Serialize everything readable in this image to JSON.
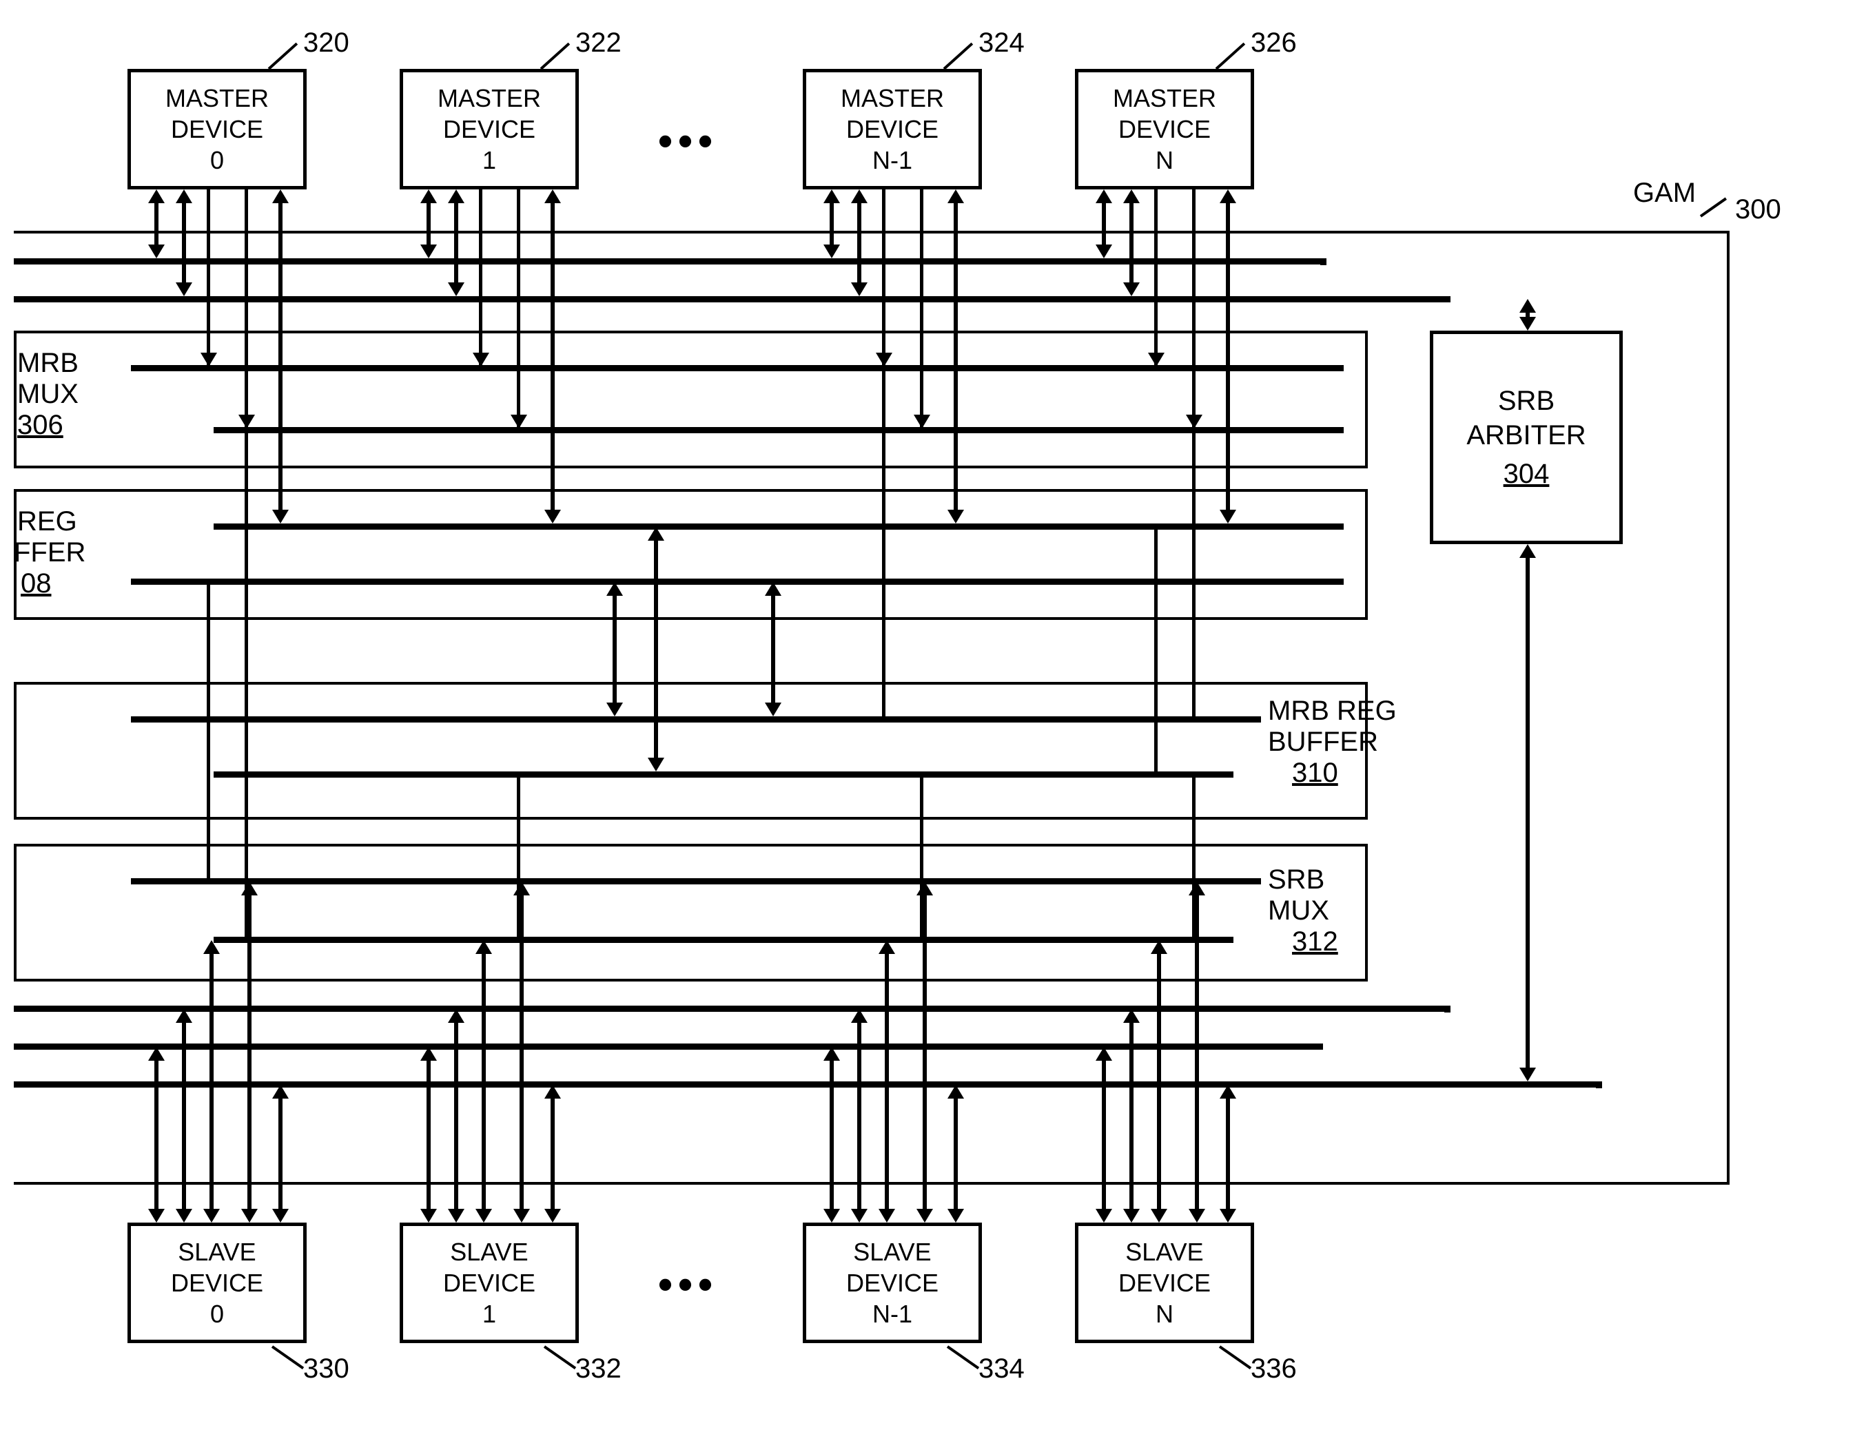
{
  "top_label": {
    "text": "GAM",
    "ref": "300"
  },
  "masters": [
    {
      "line1": "MASTER",
      "line2": "DEVICE",
      "line3": "0",
      "ref": "320"
    },
    {
      "line1": "MASTER",
      "line2": "DEVICE",
      "line3": "1",
      "ref": "322"
    },
    {
      "line1": "MASTER",
      "line2": "DEVICE",
      "line3": "N-1",
      "ref": "324"
    },
    {
      "line1": "MASTER",
      "line2": "DEVICE",
      "line3": "N",
      "ref": "326"
    }
  ],
  "slaves": [
    {
      "line1": "SLAVE",
      "line2": "DEVICE",
      "line3": "0",
      "ref": "330"
    },
    {
      "line1": "SLAVE",
      "line2": "DEVICE",
      "line3": "1",
      "ref": "332"
    },
    {
      "line1": "SLAVE",
      "line2": "DEVICE",
      "line3": "N-1",
      "ref": "334"
    },
    {
      "line1": "SLAVE",
      "line2": "DEVICE",
      "line3": "N",
      "ref": "336"
    }
  ],
  "arbiter": {
    "line1": "SRB",
    "line2": "ARBITER",
    "ref": "304"
  },
  "side_labels": {
    "mrb_mux": {
      "l1": "MRB",
      "l2": "MUX",
      "ref": "306"
    },
    "reg_ffer": {
      "l1": "REG",
      "l2": "FFER",
      "ref": "08"
    },
    "mrb_reg_buf": {
      "l1": "MRB REG",
      "l2": "BUFFER",
      "ref": "310"
    },
    "srb_mux": {
      "l1": "SRB",
      "l2": "MUX",
      "ref": "312"
    }
  },
  "ellipsis": "•••"
}
